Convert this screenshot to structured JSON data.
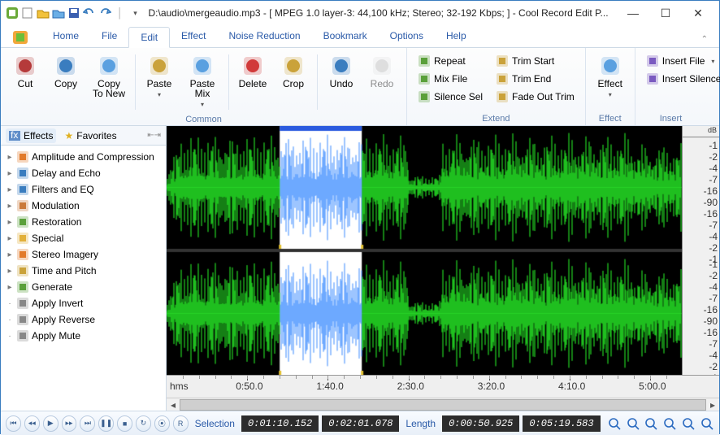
{
  "title": "D:\\audio\\mergeaudio.mp3 - [ MPEG 1.0 layer-3: 44,100 kHz; Stereo; 32-192 Kbps;  ] - Cool Record Edit P...",
  "menus": [
    "Home",
    "File",
    "Edit",
    "Effect",
    "Noise Reduction",
    "Bookmark",
    "Options",
    "Help"
  ],
  "activeMenu": 2,
  "ribbon": {
    "common": {
      "label": "Common",
      "big": [
        {
          "name": "cut",
          "label": "Cut",
          "under": "C"
        },
        {
          "name": "copy",
          "label": "Copy",
          "under": "C"
        },
        {
          "name": "copy-to-new",
          "label": "Copy\nTo New"
        },
        {
          "name": "paste",
          "label": "Paste"
        },
        {
          "name": "paste-mix",
          "label": "Paste\nMix"
        },
        {
          "name": "delete",
          "label": "Delete"
        },
        {
          "name": "crop",
          "label": "Crop"
        },
        {
          "name": "undo",
          "label": "Undo"
        },
        {
          "name": "redo",
          "label": "Redo"
        }
      ]
    },
    "extend": {
      "label": "Extend",
      "small": [
        {
          "name": "repeat",
          "label": "Repeat"
        },
        {
          "name": "mix-file",
          "label": "Mix File"
        },
        {
          "name": "silence-sel",
          "label": "Silence Sel"
        },
        {
          "name": "trim-start",
          "label": "Trim Start"
        },
        {
          "name": "trim-end",
          "label": "Trim End"
        },
        {
          "name": "fade-out-trim",
          "label": "Fade Out Trim"
        }
      ]
    },
    "effect": {
      "label": "Effect",
      "big": [
        {
          "name": "effect",
          "label": "Effect"
        }
      ]
    },
    "insert": {
      "label": "Insert",
      "small": [
        {
          "name": "insert-file",
          "label": "Insert File"
        },
        {
          "name": "insert-silence",
          "label": "Insert Silence"
        }
      ]
    }
  },
  "leftTabs": {
    "effects": "Effects",
    "favorites": "Favorites"
  },
  "tree": [
    {
      "name": "amplitude",
      "label": "Amplitude and Compression",
      "expandable": true
    },
    {
      "name": "delay",
      "label": "Delay and Echo",
      "expandable": true
    },
    {
      "name": "filters",
      "label": "Filters and EQ",
      "expandable": true
    },
    {
      "name": "modulation",
      "label": "Modulation",
      "expandable": true
    },
    {
      "name": "restoration",
      "label": "Restoration",
      "expandable": true
    },
    {
      "name": "special",
      "label": "Special",
      "expandable": true
    },
    {
      "name": "stereo",
      "label": "Stereo Imagery",
      "expandable": true
    },
    {
      "name": "time-pitch",
      "label": "Time and Pitch",
      "expandable": true
    },
    {
      "name": "generate",
      "label": "Generate",
      "expandable": true
    },
    {
      "name": "apply-invert",
      "label": "Apply Invert",
      "expandable": false
    },
    {
      "name": "apply-reverse",
      "label": "Apply Reverse",
      "expandable": false
    },
    {
      "name": "apply-mute",
      "label": "Apply Mute",
      "expandable": false
    }
  ],
  "db": {
    "unit": "dB",
    "ticks": [
      "-1",
      "-2",
      "-4",
      "-7",
      "-16",
      "-90",
      "-16",
      "-7",
      "-4",
      "-2",
      "-1"
    ]
  },
  "timeline": {
    "unit": "hms",
    "marks": [
      "0:50.0",
      "1:40.0",
      "2:30.0",
      "3:20.0",
      "4:10.0",
      "5:00.0"
    ]
  },
  "selection": {
    "label": "Selection",
    "start": "0:01:10.152",
    "end": "0:02:01.078"
  },
  "length": {
    "label": "Length",
    "val1": "0:00:50.925",
    "val2": "0:05:19.583"
  },
  "transport": [
    "skip-start",
    "prev",
    "play",
    "next",
    "skip-end",
    "pause",
    "stop",
    "loop",
    "record-toggle",
    "record"
  ],
  "wave": {
    "durationSec": 319.583,
    "selStartSec": 70.152,
    "selEndSec": 121.078,
    "colorMain": "#2bff2b",
    "colorSel": "#3c8cff",
    "bg": "#000000"
  }
}
